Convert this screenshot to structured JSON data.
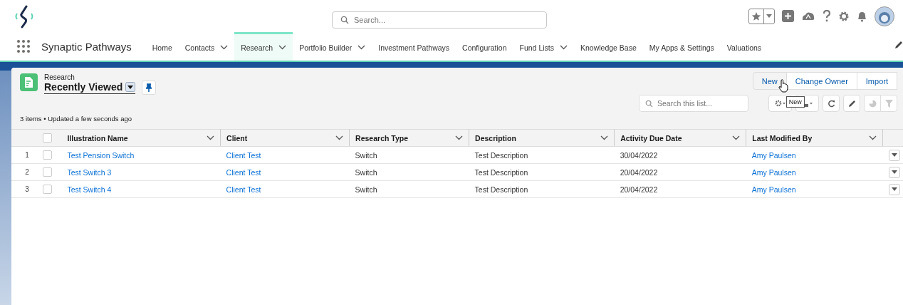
{
  "header": {
    "search": {
      "placeholder": "Search..."
    }
  },
  "nav": {
    "app_name": "Synaptic Pathways",
    "tabs": [
      {
        "label": "Home",
        "selected": false,
        "menu": false
      },
      {
        "label": "Contacts",
        "selected": false,
        "menu": true
      },
      {
        "label": "Research",
        "selected": true,
        "menu": true
      },
      {
        "label": "Portfolio Builder",
        "selected": false,
        "menu": true
      },
      {
        "label": "Investment Pathways",
        "selected": false,
        "menu": false
      },
      {
        "label": "Configuration",
        "selected": false,
        "menu": false
      },
      {
        "label": "Fund Lists",
        "selected": false,
        "menu": true
      },
      {
        "label": "Knowledge Base",
        "selected": false,
        "menu": false
      },
      {
        "label": "My Apps & Settings",
        "selected": false,
        "menu": false
      },
      {
        "label": "Valuations",
        "selected": false,
        "menu": false
      }
    ]
  },
  "list_view": {
    "object": "Research",
    "view": "Recently Viewed",
    "status": "3 items • Updated a few seconds ago",
    "actions": [
      "New",
      "Change Owner",
      "Import"
    ],
    "search": {
      "placeholder": "Search this list..."
    },
    "tooltip": "New",
    "all_selected": false,
    "columns": [
      "Illustration Name",
      "Client",
      "Research Type",
      "Description",
      "Activity Due Date",
      "Last Modified By"
    ],
    "rows": [
      {
        "number": "1",
        "checked": false,
        "cells": [
          "Test Pension Switch",
          "Client Test",
          "Switch",
          "Test Description",
          "30/04/2022",
          "Amy Paulsen"
        ]
      },
      {
        "number": "2",
        "checked": false,
        "cells": [
          "Test Switch 3",
          "Client Test",
          "Switch",
          "Test Description",
          "20/04/2022",
          "Amy Paulsen"
        ]
      },
      {
        "number": "3",
        "checked": false,
        "cells": [
          "Test Switch 4",
          "Client Test",
          "Switch",
          "Test Description",
          "20/04/2022",
          "Amy Paulsen"
        ]
      }
    ]
  }
}
